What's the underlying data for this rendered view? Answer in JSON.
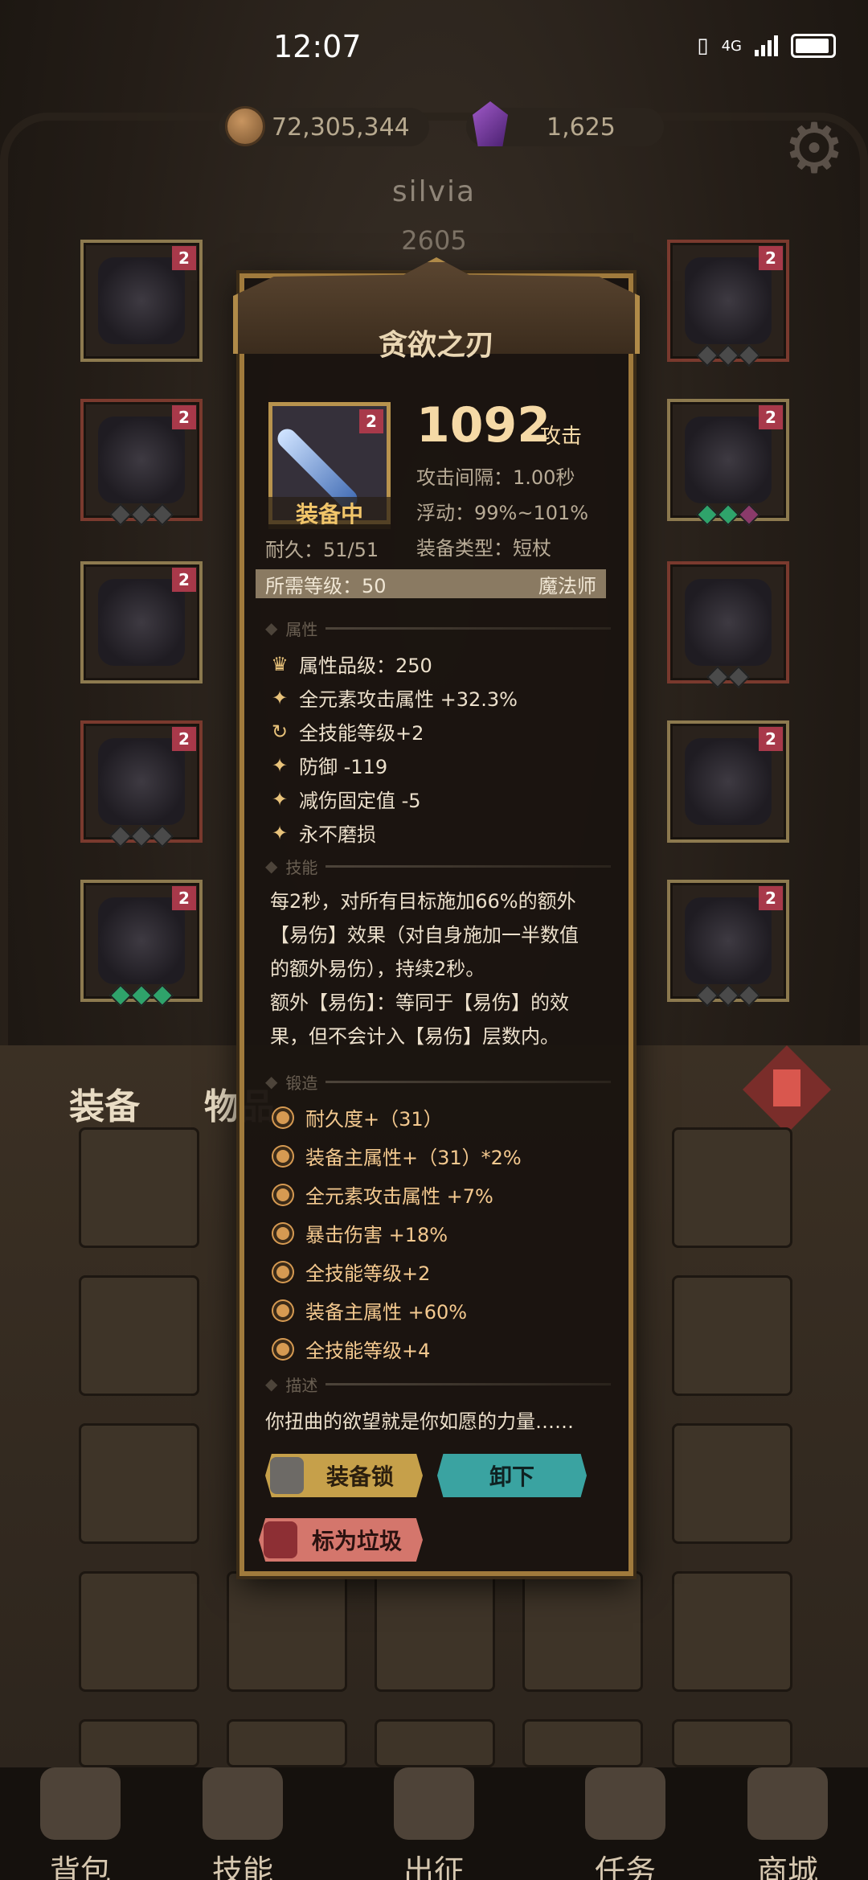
{
  "status_bar": {
    "time": "12:07",
    "network": "4G"
  },
  "currency": {
    "gold": "72,305,344",
    "gems": "1,625"
  },
  "player": {
    "name": "silvia",
    "score": "2605"
  },
  "equip_slot_badge": "2",
  "bag": {
    "tab_equipment": "装备",
    "tab_items": "物品"
  },
  "nav": [
    "背包",
    "技能",
    "出征",
    "任务",
    "商城"
  ],
  "item": {
    "name": "贪欲之刃",
    "badge": "2",
    "equipped_label": "装备中",
    "attack_value": "1092",
    "attack_unit": "攻击",
    "attack_interval": "攻击间隔：1.00秒",
    "float": "浮动：99%~101%",
    "durability": "耐久：51/51",
    "equip_type": "装备类型：短杖",
    "req_level": "所需等级：50",
    "req_class": "魔法师",
    "section_attributes": "属性",
    "attributes": [
      {
        "icon": "quality-icon",
        "glyph": "♛",
        "text": "属性品级：250"
      },
      {
        "icon": "star-icon",
        "glyph": "✦",
        "text": "全元素攻击属性 +32.3%"
      },
      {
        "icon": "cycle-icon",
        "glyph": "↻",
        "text": "全技能等级+2"
      },
      {
        "icon": "star-icon",
        "glyph": "✦",
        "text": "防御 -119"
      },
      {
        "icon": "star-icon",
        "glyph": "✦",
        "text": "减伤固定值 -5"
      },
      {
        "icon": "star-icon",
        "glyph": "✦",
        "text": "永不磨损"
      }
    ],
    "section_skill": "技能",
    "skill_lines": [
      "每2秒，对所有目标施加66%的额外",
      "【易伤】效果（对自身施加一半数值",
      "的额外易伤），持续2秒。",
      "额外【易伤】：等同于【易伤】的效",
      "果，但不会计入【易伤】层数内。"
    ],
    "section_forge": "锻造",
    "forge": [
      "耐久度+（31）",
      "装备主属性+（31）*2%",
      "全元素攻击属性 +7%",
      "暴击伤害 +18%",
      "全技能等级+2",
      "装备主属性 +60%",
      "全技能等级+4"
    ],
    "section_desc": "描述",
    "description": "你扭曲的欲望就是你如愿的力量……",
    "btn_lock": "装备锁",
    "btn_unequip": "卸下",
    "btn_trash": "标为垃圾"
  }
}
